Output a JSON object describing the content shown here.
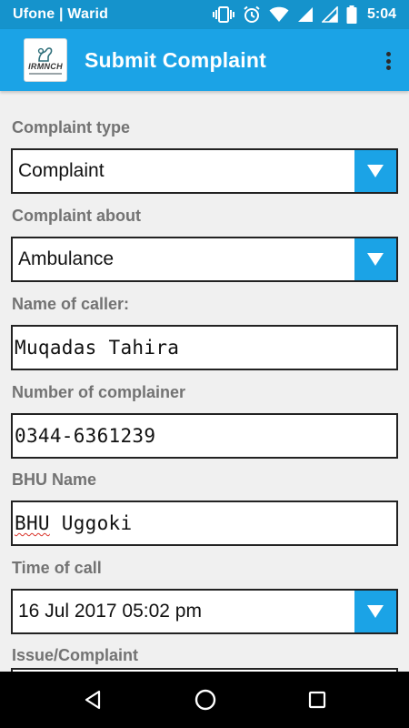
{
  "status_bar": {
    "carrier": "Ufone | Warid",
    "time": "5:04",
    "icons": [
      "vibrate-icon",
      "alarm-icon",
      "wifi-icon",
      "signal-icon",
      "signal-icon",
      "battery-icon"
    ]
  },
  "app_bar": {
    "logo_text": "IRMNCH",
    "title": "Submit Complaint",
    "overflow_icon": "more-vert-icon"
  },
  "form": {
    "complaint_type": {
      "label": "Complaint type",
      "value": "Complaint"
    },
    "complaint_about": {
      "label": "Complaint about",
      "value": "Ambulance"
    },
    "caller_name": {
      "label": "Name of caller:",
      "value": "Muqadas Tahira"
    },
    "complainer_number": {
      "label": "Number of complainer",
      "value": "0344-6361239"
    },
    "bhu_name": {
      "label": "BHU Name",
      "value_first": "BHU",
      "value_rest": " Uggoki"
    },
    "time_of_call": {
      "label": "Time of call",
      "value": "16 Jul 2017 05:02 pm"
    },
    "issue": {
      "label": "Issue/Complaint",
      "value": ""
    }
  },
  "nav_bar": {
    "icons": [
      "back-icon",
      "home-icon",
      "recents-icon"
    ]
  },
  "colors": {
    "status_bar": "#1593cc",
    "app_bar": "#1ba3e6",
    "background": "#f0f0f0",
    "label": "#737373",
    "dropdown_button": "#1ba3e6"
  }
}
